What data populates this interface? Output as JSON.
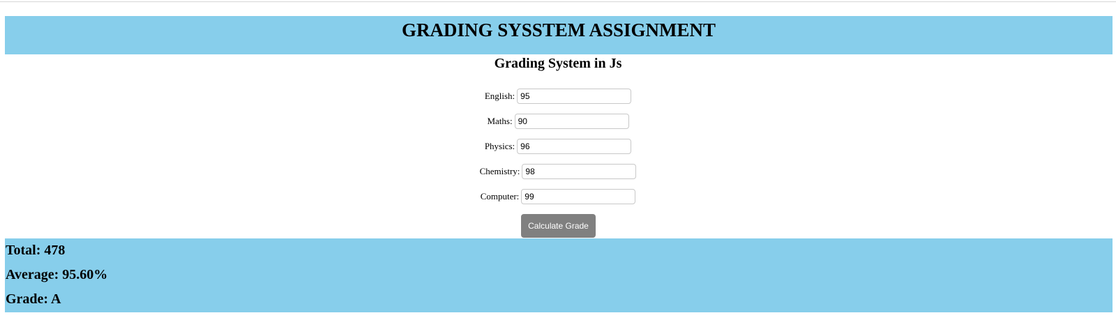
{
  "header": {
    "title": "GRADING SYSSTEM ASSIGNMENT"
  },
  "subtitle": "Grading System in Js",
  "form": {
    "fields": [
      {
        "label": "English:",
        "value": "95"
      },
      {
        "label": "Maths:",
        "value": "90"
      },
      {
        "label": "Physics:",
        "value": "96"
      },
      {
        "label": "Chemistry:",
        "value": "98"
      },
      {
        "label": "Computer:",
        "value": "99"
      }
    ],
    "button_label": "Calculate Grade"
  },
  "results": {
    "total": "Total: 478",
    "average": "Average: 95.60%",
    "grade": "Grade: A"
  },
  "colors": {
    "banner": "#87ceeb",
    "button": "#808080"
  }
}
